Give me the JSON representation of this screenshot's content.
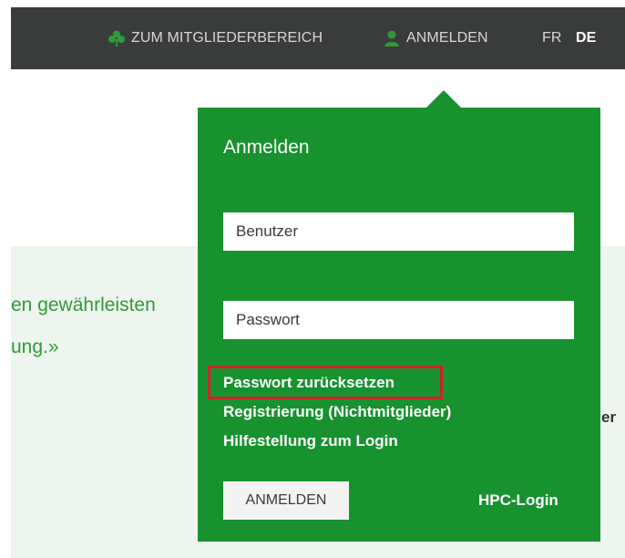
{
  "colors": {
    "topbar": "#3a3c3c",
    "panel_green": "#17922f",
    "accent_text_green": "#2f9a3a",
    "highlight_red": "#d0202a",
    "band_background": "#eef5ee"
  },
  "topnav": {
    "members_icon": "clover-icon",
    "members_label": "ZUM MITGLIEDERBEREICH",
    "login_icon": "user-icon",
    "login_label": "ANMELDEN",
    "lang_fr": "FR",
    "lang_de": "DE",
    "active_language": "DE"
  },
  "background_content": {
    "quote_line_1": "en gewährleisten",
    "quote_line_2": "ung.»",
    "right_clip": "er"
  },
  "login_panel": {
    "title": "Anmelden",
    "username_placeholder": "Benutzer",
    "username_value": "",
    "password_placeholder": "Passwort",
    "password_value": "",
    "links": {
      "reset_password": "Passwort zurücksetzen",
      "register": "Registrierung (Nichtmitglieder)",
      "help": "Hilfestellung zum Login"
    },
    "submit_label": "ANMELDEN",
    "hpc_login": "HPC-Login"
  }
}
